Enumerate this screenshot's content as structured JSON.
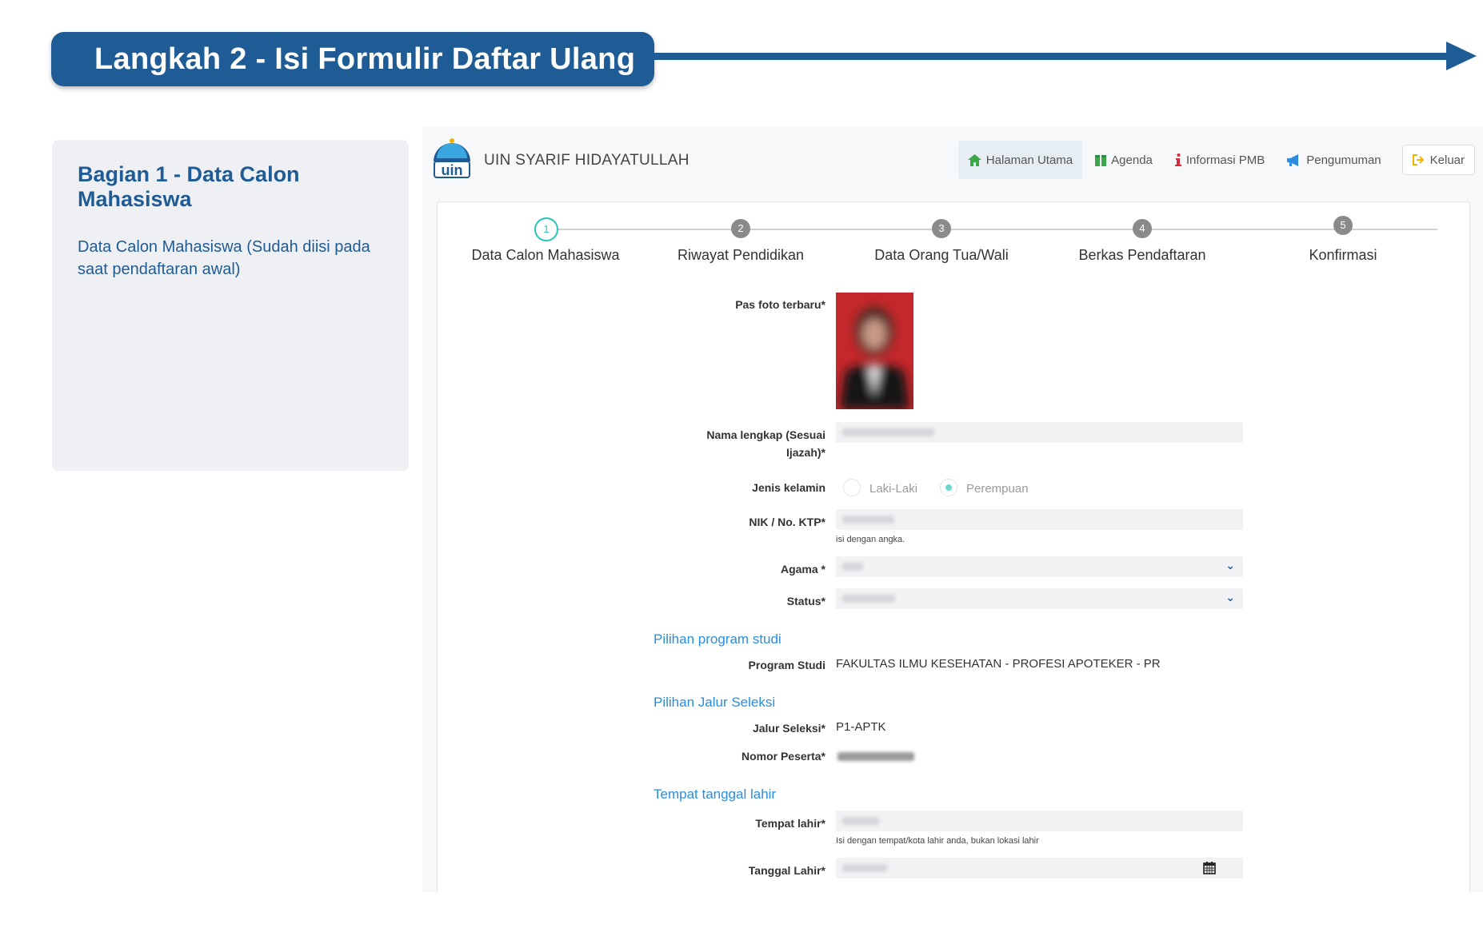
{
  "banner": {
    "title": "Langkah 2 - Isi Formulir Daftar Ulang"
  },
  "side": {
    "title": "Bagian 1 - Data Calon Mahasiswa",
    "description": "Data Calon Mahasiswa (Sudah diisi pada saat pendaftaran awal)"
  },
  "header": {
    "brand": "UIN SYARIF HIDAYATULLAH",
    "nav": [
      {
        "label": "Halaman Utama",
        "icon": "home-icon",
        "color": "#3aa84a"
      },
      {
        "label": "Agenda",
        "icon": "calendar-gift-icon",
        "color": "#3aa84a"
      },
      {
        "label": "Informasi PMB",
        "icon": "info-icon",
        "color": "#d62b3a"
      },
      {
        "label": "Pengumuman",
        "icon": "megaphone-icon",
        "color": "#2a8ddd"
      },
      {
        "label": "Keluar",
        "icon": "logout-icon",
        "color": "#f0b400"
      }
    ]
  },
  "stepper": {
    "active_color": "#27c5b9",
    "steps": [
      {
        "num": "1",
        "label": "Data Calon Mahasiswa"
      },
      {
        "num": "2",
        "label": "Riwayat Pendidikan"
      },
      {
        "num": "3",
        "label": "Data Orang Tua/Wali"
      },
      {
        "num": "4",
        "label": "Berkas Pendaftaran"
      },
      {
        "num": "5",
        "label": "Konfirmasi"
      }
    ]
  },
  "form": {
    "photo_label": "Pas foto terbaru*",
    "nama_label_line1": "Nama lengkap (Sesuai",
    "nama_label_line2": "Ijazah)*",
    "gender_label": "Jenis kelamin",
    "gender_options": [
      "Laki-Laki",
      "Perempuan"
    ],
    "gender_selected": "Perempuan",
    "nik_label": "NIK / No. KTP*",
    "nik_hint": "isi dengan angka.",
    "agama_label": "Agama *",
    "status_label": "Status*",
    "section_prodi": "Pilihan program studi",
    "prodi_label": "Program Studi",
    "prodi_value": "FAKULTAS ILMU KESEHATAN - PROFESI APOTEKER - PR",
    "section_jalur": "Pilihan Jalur Seleksi",
    "jalur_label": "Jalur Seleksi*",
    "jalur_value": "P1-APTK",
    "nomor_label": "Nomor Peserta*",
    "section_ttl": "Tempat tanggal lahir",
    "tempat_label": "Tempat lahir*",
    "tempat_hint": "Isi dengan tempat/kota lahir anda, bukan lokasi lahir",
    "tanggal_label": "Tanggal Lahir*"
  }
}
